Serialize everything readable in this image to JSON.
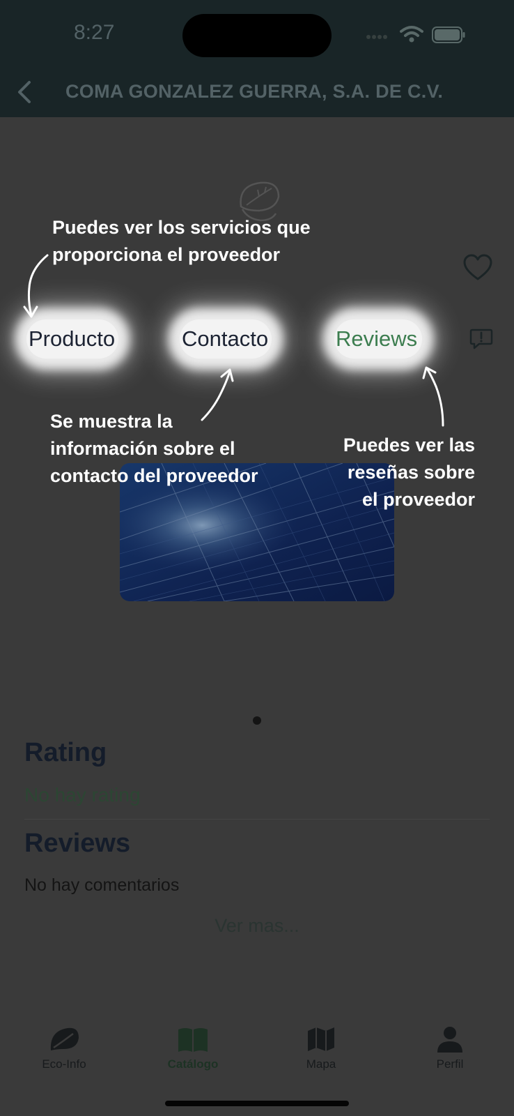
{
  "status_bar": {
    "time": "8:27"
  },
  "nav": {
    "title": "COMA GONZALEZ GUERRA, S.A. DE C.V."
  },
  "tabs": [
    {
      "label": "Producto",
      "active": false
    },
    {
      "label": "Contacto",
      "active": false
    },
    {
      "label": "Reviews",
      "active": true
    }
  ],
  "annotations": {
    "productos": "Puedes ver los servicios que proporciona el proveedor",
    "contacto": "Se muestra la información sobre el contacto del proveedor",
    "reviews": "Puedes ver las reseñas sobre el proveedor"
  },
  "carousel": {
    "image": "solar-panels",
    "pages": 1,
    "current_page": 1
  },
  "rating": {
    "title": "Rating",
    "value": "No hay rating"
  },
  "reviews": {
    "title": "Reviews",
    "empty_text": "No hay comentarios",
    "more_label": "Ver mas..."
  },
  "tabbar": [
    {
      "label": "Eco-Info",
      "icon": "leaf-icon",
      "active": false
    },
    {
      "label": "Catálogo",
      "icon": "book-icon",
      "active": true
    },
    {
      "label": "Mapa",
      "icon": "map-icon",
      "active": false
    },
    {
      "label": "Perfil",
      "icon": "person-icon",
      "active": false
    }
  ],
  "colors": {
    "accent_green": "#3c7d4f",
    "header_bg": "#192527",
    "overlay_bg": "#3a3a3a"
  }
}
